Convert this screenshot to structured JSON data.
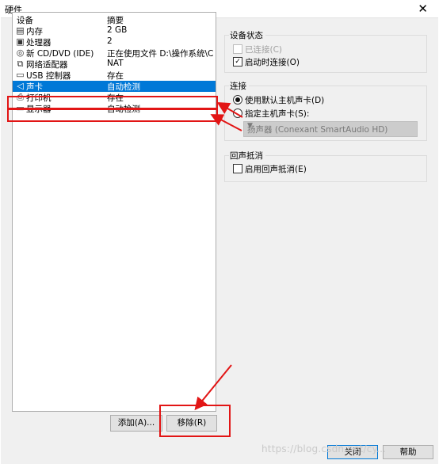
{
  "window": {
    "title": "硬件",
    "close_glyph": "✕"
  },
  "device_list": {
    "headers": {
      "device": "设备",
      "summary": "摘要"
    },
    "items": [
      {
        "icon": "memory-icon",
        "glyph": "▤",
        "name": "内存",
        "summary": "2 GB"
      },
      {
        "icon": "processor-icon",
        "glyph": "▣",
        "name": "处理器",
        "summary": "2"
      },
      {
        "icon": "cd-dvd-icon",
        "glyph": "◎",
        "name": "新 CD/DVD (IDE)",
        "summary": "正在使用文件 D:\\操作系统\\C..."
      },
      {
        "icon": "network-adapter-icon",
        "glyph": "⧉",
        "name": "网络适配器",
        "summary": "NAT"
      },
      {
        "icon": "usb-controller-icon",
        "glyph": "▭",
        "name": "USB 控制器",
        "summary": "存在"
      },
      {
        "icon": "sound-card-icon",
        "glyph": "◁",
        "name": "声卡",
        "summary": "自动检测"
      },
      {
        "icon": "printer-icon",
        "glyph": "⎙",
        "name": "打印机",
        "summary": "存在"
      },
      {
        "icon": "display-icon",
        "glyph": "▭",
        "name": "显示器",
        "summary": "自动检测"
      }
    ]
  },
  "buttons": {
    "add": "添加(A)...",
    "remove": "移除(R)",
    "ok": "关闭",
    "help": "帮助"
  },
  "device_status": {
    "title": "设备状态",
    "connected": {
      "label": "已连接(C)",
      "checked": false,
      "enabled": false
    },
    "connect_at_power_on": {
      "label": "启动时连接(O)",
      "checked": true
    }
  },
  "connection": {
    "title": "连接",
    "use_default": {
      "label": "使用默认主机声卡(D)",
      "selected": true
    },
    "specify": {
      "label": "指定主机声卡(S):",
      "selected": false
    },
    "device_select": "扬声器 (Conexant SmartAudio HD)"
  },
  "echo_cancel": {
    "title": "回声抵消",
    "enable": {
      "label": "启用回声抵消(E)",
      "checked": false
    }
  },
  "watermark": "https://blog.csdn.net/cy..."
}
